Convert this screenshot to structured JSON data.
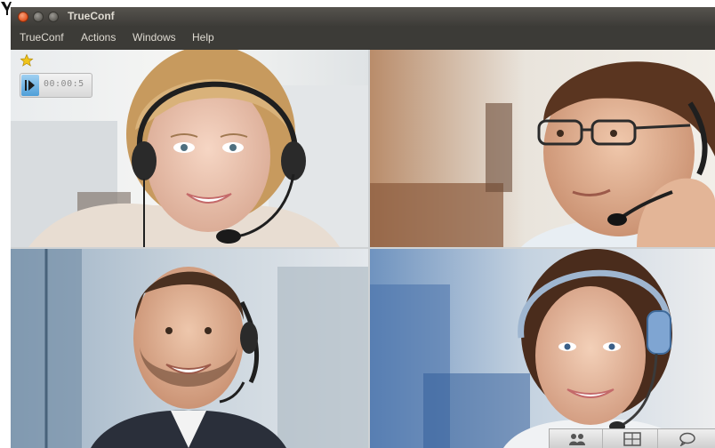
{
  "window": {
    "title": "TrueConf"
  },
  "menu": {
    "items": [
      "TrueConf",
      "Actions",
      "Windows",
      "Help"
    ]
  },
  "recording": {
    "timer": "00:00:5"
  },
  "icons": {
    "close": "close-icon",
    "minimize": "minimize-icon",
    "maximize": "maximize-icon",
    "favorite": "star-icon",
    "play": "play-icon",
    "participants": "participants-icon",
    "layout": "layout-icon",
    "chat": "chat-icon"
  },
  "colors": {
    "titlebar": "#3c3b37",
    "menu_text": "#dfdbd2",
    "close": "#e0531f",
    "accent": "#4f9fd8",
    "star": "#f0c419"
  }
}
